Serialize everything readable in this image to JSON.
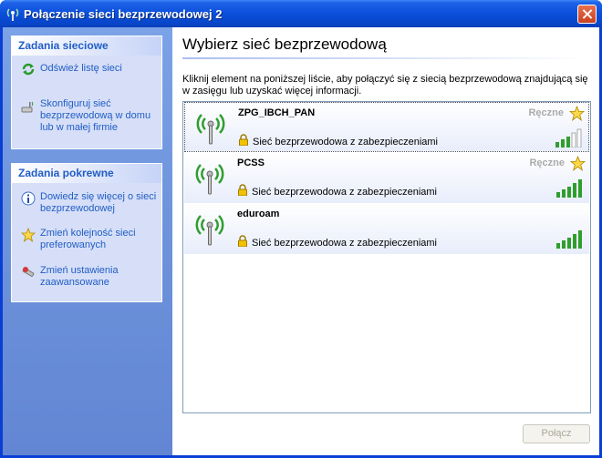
{
  "window": {
    "title": "Połączenie sieci bezprzewodowej 2"
  },
  "sidebar": {
    "network_tasks": {
      "header": "Zadania sieciowe",
      "items": [
        {
          "label": "Odśwież listę sieci",
          "icon": "refresh-icon"
        },
        {
          "label": "Skonfiguruj sieć bezprzewodową w domu lub w małej firmie",
          "icon": "wireless-setup-icon"
        }
      ]
    },
    "related_tasks": {
      "header": "Zadania pokrewne",
      "items": [
        {
          "label": "Dowiedz się więcej o sieci bezprzewodowej",
          "icon": "info-icon"
        },
        {
          "label": "Zmień kolejność sieci preferowanych",
          "icon": "star-icon"
        },
        {
          "label": "Zmień ustawienia zaawansowane",
          "icon": "settings-icon"
        }
      ]
    }
  },
  "main": {
    "heading": "Wybierz sieć bezprzewodową",
    "description": "Kliknij element na poniższej liście, aby połączyć się z siecią bezprzewodową znajdującą się w zasięgu lub uzyskać więcej informacji.",
    "networks": [
      {
        "name": "ZPG_IBCH_PAN",
        "security": "Sieć bezprzewodowa z zabezpieczeniami",
        "mode": "Ręczne",
        "preferred": true,
        "signal_bars": 3,
        "selected": true
      },
      {
        "name": "PCSS",
        "security": "Sieć bezprzewodowa z zabezpieczeniami",
        "mode": "Ręczne",
        "preferred": true,
        "signal_bars": 5,
        "selected": false
      },
      {
        "name": "eduroam",
        "security": "Sieć bezprzewodowa z zabezpieczeniami",
        "mode": "",
        "preferred": false,
        "signal_bars": 5,
        "selected": false
      }
    ],
    "connect_label": "Połącz"
  },
  "colors": {
    "title_bar": "#0a4fdc",
    "sidebar_bg": "#6f95dd",
    "task_link": "#215dc6",
    "signal_on": "#2f9e2f",
    "signal_off": "#d8d8d8"
  }
}
